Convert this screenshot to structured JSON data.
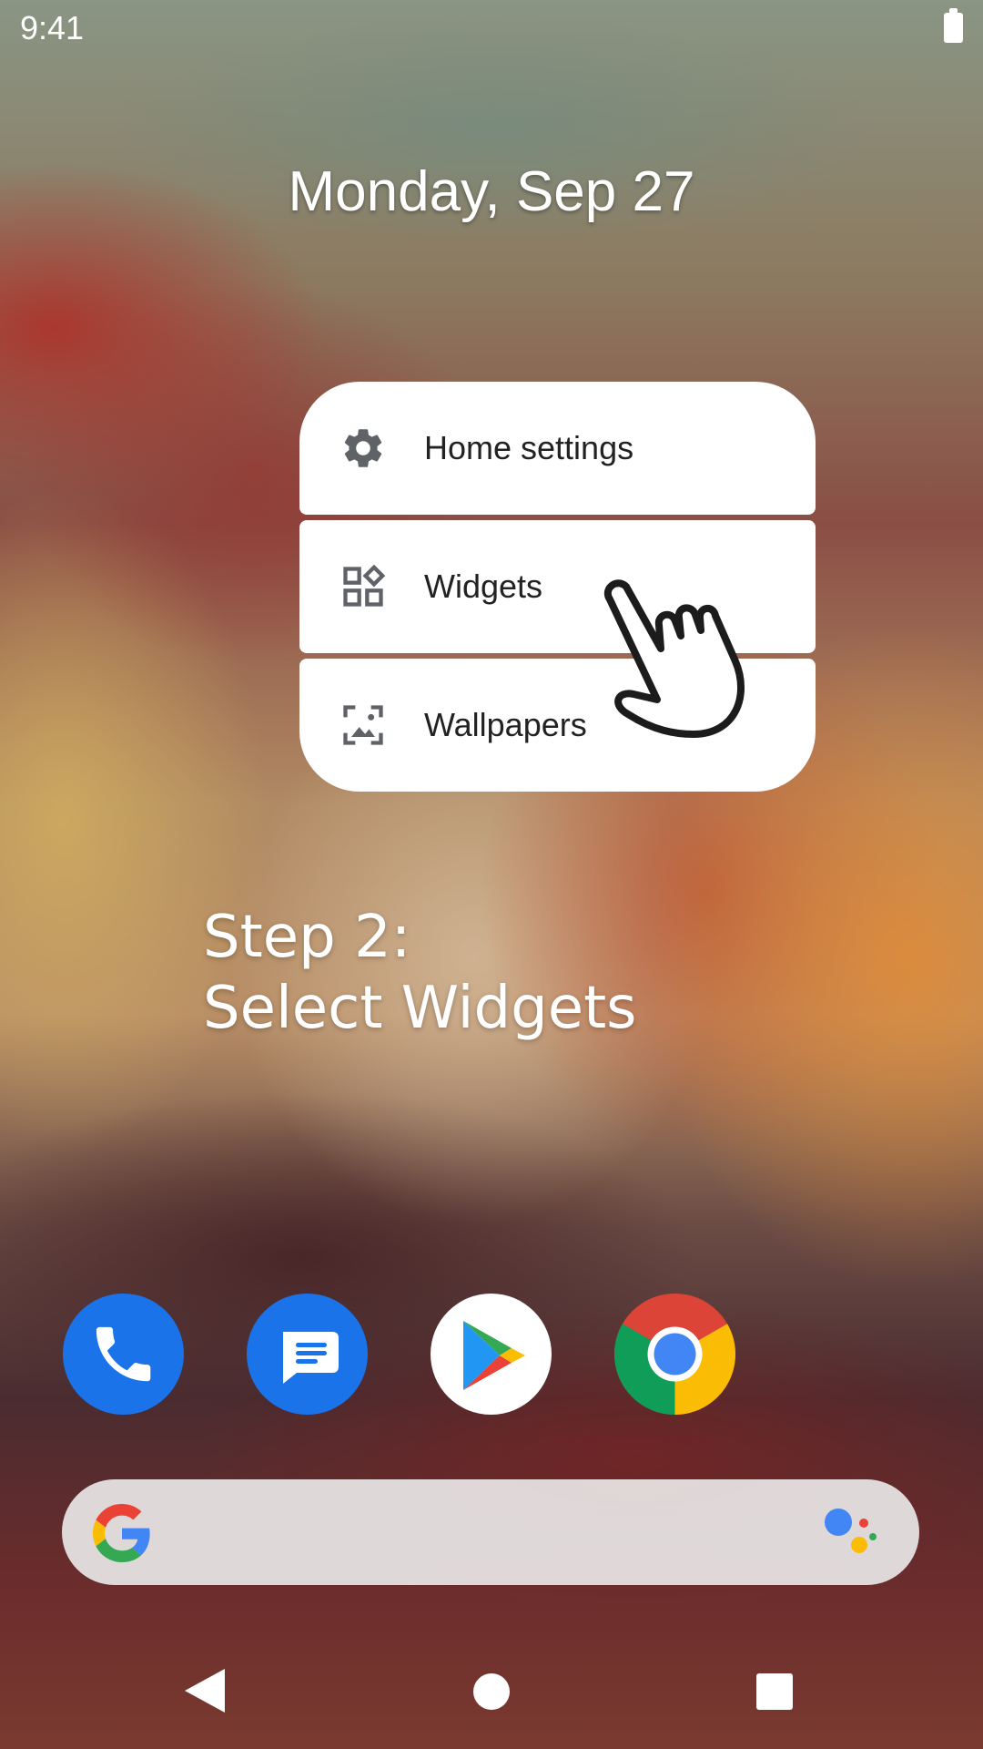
{
  "status_bar": {
    "time": "9:41"
  },
  "home": {
    "date": "Monday, Sep 27"
  },
  "context_menu": {
    "items": [
      {
        "label": "Home settings",
        "icon": "gear-icon"
      },
      {
        "label": "Widgets",
        "icon": "widgets-icon"
      },
      {
        "label": "Wallpapers",
        "icon": "wallpaper-icon"
      }
    ]
  },
  "instruction": {
    "line1": "Step 2:",
    "line2": "Select Widgets"
  },
  "dock": {
    "apps": [
      {
        "icon": "phone-icon",
        "color": "#1a73e8"
      },
      {
        "icon": "messages-icon",
        "color": "#1a73e8"
      },
      {
        "icon": "play-store-icon",
        "color": "#ffffff"
      },
      {
        "icon": "chrome-icon",
        "color": "#db4437"
      }
    ]
  },
  "search_bar": {
    "left_icon": "google-g-icon",
    "right_icon": "assistant-icon"
  },
  "nav_bar": {
    "buttons": [
      "back-button",
      "home-button",
      "recents-button"
    ]
  }
}
